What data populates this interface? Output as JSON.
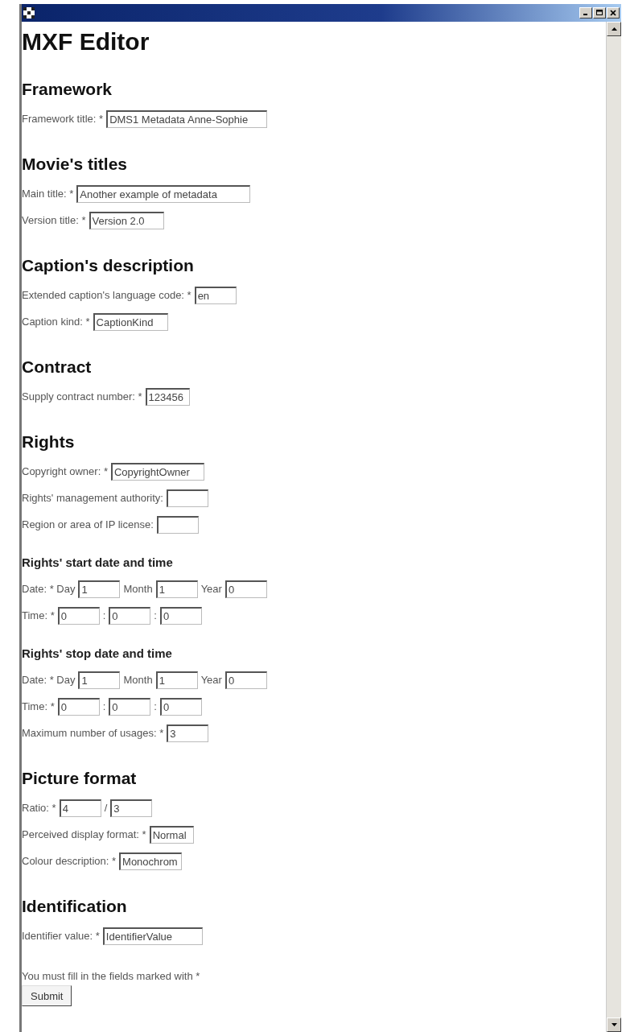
{
  "page": {
    "title": "MXF Editor"
  },
  "sections": [
    {
      "heading": "Framework",
      "kind": "major",
      "rows": [
        {
          "items": [
            {
              "kind": "label",
              "text": "Framework title: *"
            },
            {
              "kind": "field",
              "value": "DMS1 Metadata Anne-Sophie"
            }
          ]
        }
      ]
    },
    {
      "heading": "Movie's titles",
      "kind": "major",
      "rows": [
        {
          "items": [
            {
              "kind": "label",
              "text": "Main title: *"
            },
            {
              "kind": "field",
              "value": "Another example of metadata"
            }
          ]
        },
        {
          "items": [
            {
              "kind": "label",
              "text": "Version title: *"
            },
            {
              "kind": "field",
              "value": "Version 2.0"
            }
          ]
        }
      ]
    },
    {
      "heading": "Caption's description",
      "kind": "major",
      "rows": [
        {
          "items": [
            {
              "kind": "label",
              "text": "Extended caption's language code: *"
            },
            {
              "kind": "field",
              "value": "en"
            }
          ]
        },
        {
          "items": [
            {
              "kind": "label",
              "text": "Caption kind: *"
            },
            {
              "kind": "field",
              "value": "CaptionKind"
            }
          ]
        }
      ]
    },
    {
      "heading": "Contract",
      "kind": "major",
      "rows": [
        {
          "items": [
            {
              "kind": "label",
              "text": "Supply contract number: *"
            },
            {
              "kind": "field",
              "value": "123456"
            }
          ]
        }
      ]
    },
    {
      "heading": "Rights",
      "kind": "major",
      "rows": [
        {
          "items": [
            {
              "kind": "label",
              "text": "Copyright owner: *"
            },
            {
              "kind": "field",
              "value": "CopyrightOwner"
            }
          ]
        },
        {
          "items": [
            {
              "kind": "label",
              "text": "Rights' management authority:"
            },
            {
              "kind": "field"
            }
          ]
        },
        {
          "items": [
            {
              "kind": "label",
              "text": "Region or area of IP license:"
            },
            {
              "kind": "field"
            }
          ]
        }
      ]
    },
    {
      "heading": "Rights' start date and time",
      "kind": "minor",
      "rows": [
        {
          "items": [
            {
              "kind": "label",
              "text": "Date: * Day"
            },
            {
              "kind": "field",
              "value": "1"
            },
            {
              "kind": "label",
              "text": "Month"
            },
            {
              "kind": "field",
              "value": "1"
            },
            {
              "kind": "label",
              "text": "Year"
            },
            {
              "kind": "field",
              "value": "0"
            }
          ]
        },
        {
          "items": [
            {
              "kind": "label",
              "text": "Time: *"
            },
            {
              "kind": "field",
              "value": "0"
            },
            {
              "kind": "label",
              "text": ":"
            },
            {
              "kind": "field",
              "value": "0"
            },
            {
              "kind": "label",
              "text": ":"
            },
            {
              "kind": "field",
              "value": "0"
            }
          ]
        }
      ]
    },
    {
      "heading": "Rights' stop date and time",
      "kind": "minor",
      "rows": [
        {
          "items": [
            {
              "kind": "label",
              "text": "Date: * Day"
            },
            {
              "kind": "field",
              "value": "1"
            },
            {
              "kind": "label",
              "text": "Month"
            },
            {
              "kind": "field",
              "value": "1"
            },
            {
              "kind": "label",
              "text": "Year"
            },
            {
              "kind": "field",
              "value": "0"
            }
          ]
        },
        {
          "items": [
            {
              "kind": "label",
              "text": "Time: *"
            },
            {
              "kind": "field",
              "value": "0"
            },
            {
              "kind": "label",
              "text": ":"
            },
            {
              "kind": "field",
              "value": "0"
            },
            {
              "kind": "label",
              "text": ":"
            },
            {
              "kind": "field",
              "value": "0"
            }
          ]
        },
        {
          "items": [
            {
              "kind": "label",
              "text": "Maximum number of usages: *"
            },
            {
              "kind": "field",
              "value": "3"
            }
          ]
        }
      ]
    },
    {
      "heading": "Picture format",
      "kind": "major",
      "rows": [
        {
          "items": [
            {
              "kind": "label",
              "text": "Ratio: *"
            },
            {
              "kind": "field",
              "value": "4"
            },
            {
              "kind": "label",
              "text": "/"
            },
            {
              "kind": "field",
              "value": "3"
            }
          ]
        },
        {
          "items": [
            {
              "kind": "label",
              "text": "Perceived display format: *"
            },
            {
              "kind": "field",
              "value": "Normal"
            }
          ]
        },
        {
          "items": [
            {
              "kind": "label",
              "text": "Colour description: *"
            },
            {
              "kind": "field",
              "value": "Monochrom"
            }
          ]
        }
      ]
    },
    {
      "heading": "Identification",
      "kind": "major",
      "rows": [
        {
          "items": [
            {
              "kind": "label",
              "text": "Identifier value: *"
            },
            {
              "kind": "field",
              "value": "IdentifierValue"
            }
          ]
        }
      ]
    }
  ],
  "note": "You must fill in the fields marked with *",
  "submit": "Submit"
}
